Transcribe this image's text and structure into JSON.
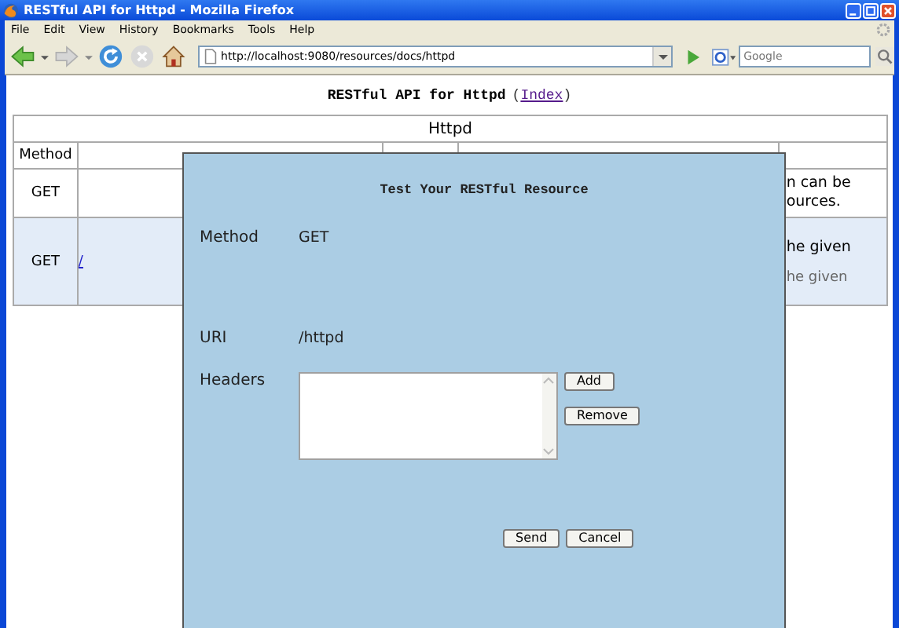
{
  "window": {
    "title": "RESTful API for Httpd - Mozilla Firefox"
  },
  "menu": [
    "File",
    "Edit",
    "View",
    "History",
    "Bookmarks",
    "Tools",
    "Help"
  ],
  "toolbar": {
    "url": "http://localhost:9080/resources/docs/httpd",
    "search_placeholder": "Google"
  },
  "page": {
    "heading": "RESTful API for Httpd",
    "index_open": "(",
    "index_link": "Index",
    "index_close": ")"
  },
  "table": {
    "title": "Httpd",
    "columns": [
      "Method"
    ],
    "rows": [
      {
        "method": "GET",
        "highlighted": false,
        "description": [
          "n can be",
          "ources."
        ]
      },
      {
        "method": "GET",
        "highlighted": true,
        "link": "/",
        "description": [
          "he given"
        ],
        "note": "he given"
      }
    ]
  },
  "dialog": {
    "title": "Test Your RESTful Resource",
    "fields": [
      {
        "label": "Method",
        "value": "GET"
      },
      {
        "label": "URI",
        "value": "/httpd"
      }
    ],
    "headers_label": "Headers",
    "header_buttons": [
      "Add",
      "Remove"
    ],
    "actions": [
      "Send",
      "Cancel"
    ]
  }
}
